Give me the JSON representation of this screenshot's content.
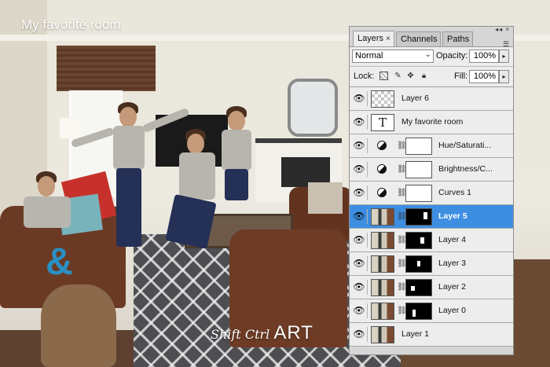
{
  "photo": {
    "title_overlay": "My favorite room",
    "brand_script": "Shift Ctrl",
    "brand_caps": "ART"
  },
  "panel": {
    "tabs": [
      {
        "label": "Layers",
        "active": true,
        "close": "×"
      },
      {
        "label": "Channels",
        "active": false
      },
      {
        "label": "Paths",
        "active": false
      }
    ],
    "panel_controls": "◂◂ ×",
    "menu_icon": "menu-icon",
    "blend_mode": "Normal",
    "opacity_label": "Opacity:",
    "opacity_value": "100%",
    "lock_label": "Lock:",
    "fill_label": "Fill:",
    "fill_value": "100%",
    "lock_icons": [
      "lock-transparent-icon",
      "lock-brush-icon",
      "lock-move-icon",
      "lock-all-icon"
    ],
    "layers": [
      {
        "name": "Layer 6",
        "kind": "transparent",
        "visible": true,
        "selected": false
      },
      {
        "name": "My favorite room",
        "kind": "text",
        "visible": true,
        "selected": false
      },
      {
        "name": "Hue/Saturati...",
        "kind": "adjustment",
        "visible": true,
        "selected": false
      },
      {
        "name": "Brightness/C...",
        "kind": "adjustment",
        "visible": true,
        "selected": false
      },
      {
        "name": "Curves 1",
        "kind": "adjustment",
        "visible": true,
        "selected": false
      },
      {
        "name": "Layer 5",
        "kind": "masked",
        "visible": true,
        "selected": true
      },
      {
        "name": "Layer 4",
        "kind": "masked",
        "visible": true,
        "selected": false
      },
      {
        "name": "Layer 3",
        "kind": "masked",
        "visible": true,
        "selected": false
      },
      {
        "name": "Layer 2",
        "kind": "masked",
        "visible": true,
        "selected": false
      },
      {
        "name": "Layer 0",
        "kind": "masked",
        "visible": true,
        "selected": false
      },
      {
        "name": "Layer 1",
        "kind": "photo",
        "visible": true,
        "selected": false
      }
    ],
    "text_thumb_glyph": "T",
    "colors": {
      "selected_row": "#3d8ee0",
      "panel_bg": "#ededed"
    }
  }
}
